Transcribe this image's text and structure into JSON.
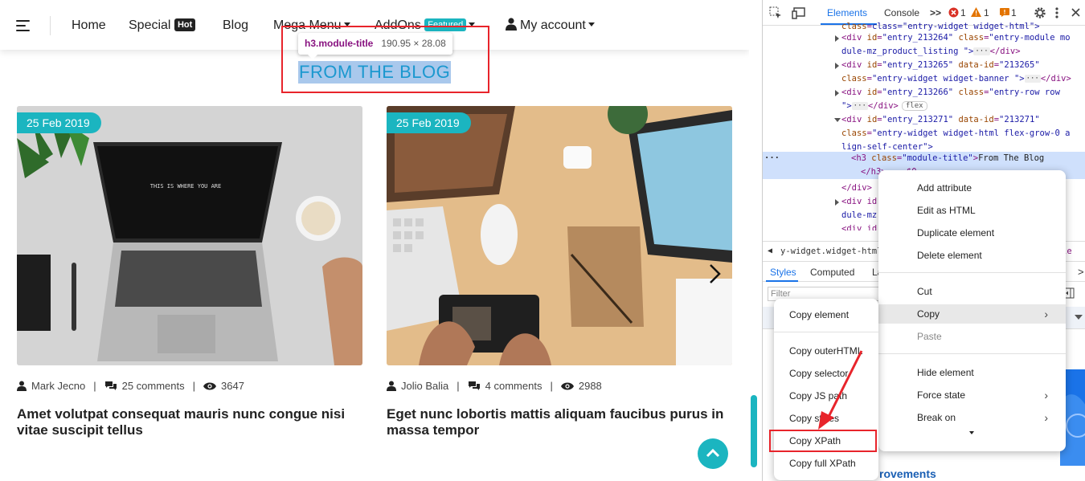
{
  "nav": {
    "home": "Home",
    "special": "Special",
    "hot_badge": "Hot",
    "blog": "Blog",
    "mega_menu": "Mega Menu",
    "addons": "AddOns",
    "featured_badge": "Featured",
    "my_account": "My account"
  },
  "inspector_tooltip": {
    "selector": "h3.module-title",
    "size": "190.95 × 28.08"
  },
  "section_title": "FROM THE BLOG",
  "posts": [
    {
      "date": "25 Feb 2019",
      "author": "Mark Jecno",
      "comments": "25 comments",
      "views": "3647",
      "title": "Amet volutpat consequat mauris nunc congue nisi vitae suscipit tellus"
    },
    {
      "date": "25 Feb 2019",
      "author": "Jolio Balia",
      "comments": "4 comments",
      "views": "2988",
      "title": "Eget nunc lobortis mattis aliquam faucibus purus in massa tempor"
    }
  ],
  "devtools": {
    "tabs": {
      "elements": "Elements",
      "console": "Console",
      "more": ">>"
    },
    "counts": {
      "errors": "1",
      "warnings": "1",
      "issues": "1"
    },
    "dom": {
      "l0": "class=\"entry-widget widget-html\">",
      "l1_id": "entry_213264",
      "l1_class": "entry-module mo",
      "l2": "dule-mz_product_listing \">",
      "l3_id": "entry_213265",
      "l3_dataid": "213265",
      "l4_class": "entry-widget widget-banner \">",
      "l5_id": "entry_213266",
      "l5_class": "entry-row row",
      "l6_end": "\">",
      "flex": "flex",
      "l7_id": "entry_213271",
      "l7_dataid": "213271",
      "l8_class": "entry-widget widget-html flex-grow-0 a",
      "l9": "lign-self-center\">",
      "l10_class": "module-title",
      "l10_text": "From The Blog",
      "l11": "</h3> == $0",
      "l12": "</div>",
      "l13": "<div id",
      "l14": "dule-mz",
      "l15": "<div id"
    },
    "breadcrumb": "y-widget.widget-html.f",
    "breadcrumb_right": "le",
    "styles_tabs": {
      "styles": "Styles",
      "computed": "Computed",
      "layout": "La"
    },
    "filter_placeholder": "Filter",
    "bottom_text": "rovements"
  },
  "context_menu": {
    "items": [
      "Add attribute",
      "Edit as HTML",
      "Duplicate element",
      "Delete element",
      "Cut",
      "Copy",
      "Paste",
      "Hide element",
      "Force state",
      "Break on"
    ]
  },
  "copy_submenu": {
    "items": [
      "Copy element",
      "Copy outerHTML",
      "Copy selector",
      "Copy JS path",
      "Copy styles",
      "Copy XPath",
      "Copy full XPath"
    ]
  },
  "colors": {
    "accent": "#1bb5c0",
    "highlight_red": "#e8242b",
    "devtools_blue": "#1a73e8",
    "tag": "#881280",
    "attr_name": "#994500",
    "attr_value": "#1a1aa6"
  }
}
